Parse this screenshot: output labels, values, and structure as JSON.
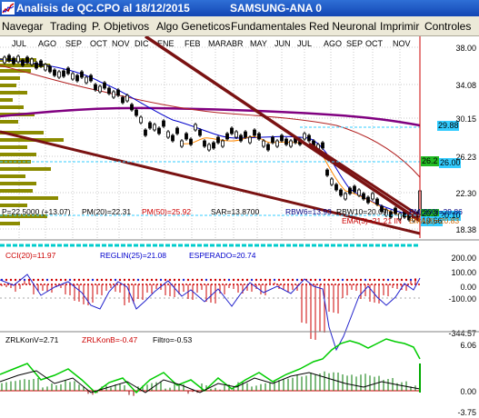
{
  "window": {
    "title": "Analisis de QC.CPO al 18/12/2015",
    "symbol": "SAMSUNG-ANA 0"
  },
  "menu": [
    "Navegar",
    "Trading",
    "P. Objetivos",
    "Algo Geneticos",
    "Fundamentales",
    "Red Neuronal",
    "Imprimir",
    "Controles"
  ],
  "price_chart": {
    "months": [
      "JUL",
      "AGO",
      "SEP",
      "OCT",
      "NOV",
      "DIC",
      "ENE",
      "FEB",
      "MAR",
      "ABR",
      "MAY",
      "JUN",
      "JUL",
      "AGO",
      "SEP",
      "OCT",
      "NOV"
    ],
    "y_ticks": [
      "38.00",
      "34.08",
      "30.15",
      "26.23",
      "22.30",
      "18.38"
    ],
    "price_markers": [
      {
        "label": "29.88",
        "color": "#33ccff"
      },
      {
        "label": "26.2",
        "color": "#22bb22"
      },
      {
        "label": "26.00",
        "color": "#33ccff"
      },
      {
        "label": "20.3",
        "color": "#22bb22"
      },
      {
        "label": "20.10",
        "color": "#33ccff"
      },
      {
        "label": "19.66",
        "color": "#33ccff"
      }
    ],
    "stats": [
      {
        "text": "P=22.5000 (+13.07)",
        "color": "#000000"
      },
      {
        "text": "PM(20)=22.31",
        "color": "#000000"
      },
      {
        "text": "PM(50)=25.92",
        "color": "#cc0000"
      },
      {
        "text": "SAR=13.8700",
        "color": "#000000"
      },
      {
        "text": "RBW6=13.93",
        "color": "#000080"
      },
      {
        "text": "RBW10=20.09",
        "color": "#000000"
      },
      {
        "text": "EMA(3)=21.21 IN",
        "color": "#cc0000"
      },
      {
        "text": "PM(200)=29.86",
        "color": "#000080"
      },
      {
        "text": "EMA(8)=20.83",
        "color": "#cc6600"
      }
    ]
  },
  "cci_panel": {
    "labels": [
      {
        "text": "CCI(20)=11.97",
        "color": "#cc0000"
      },
      {
        "text": "REGLIN(25)=21.08",
        "color": "#0000cc"
      },
      {
        "text": "ESPERADO=20.74",
        "color": "#0000cc"
      }
    ],
    "y_ticks": [
      "200.00",
      "100.00",
      "0.00",
      "-100.00",
      "-344.57"
    ]
  },
  "zrl_panel": {
    "labels": [
      {
        "text": "ZRLKonV=2.71",
        "color": "#000000"
      },
      {
        "text": "ZRLKonB=-0.47",
        "color": "#cc0000"
      },
      {
        "text": "Filtro=-0.53",
        "color": "#000000"
      }
    ],
    "y_ticks": [
      "6.06",
      "0.00",
      "-3.75"
    ]
  }
}
